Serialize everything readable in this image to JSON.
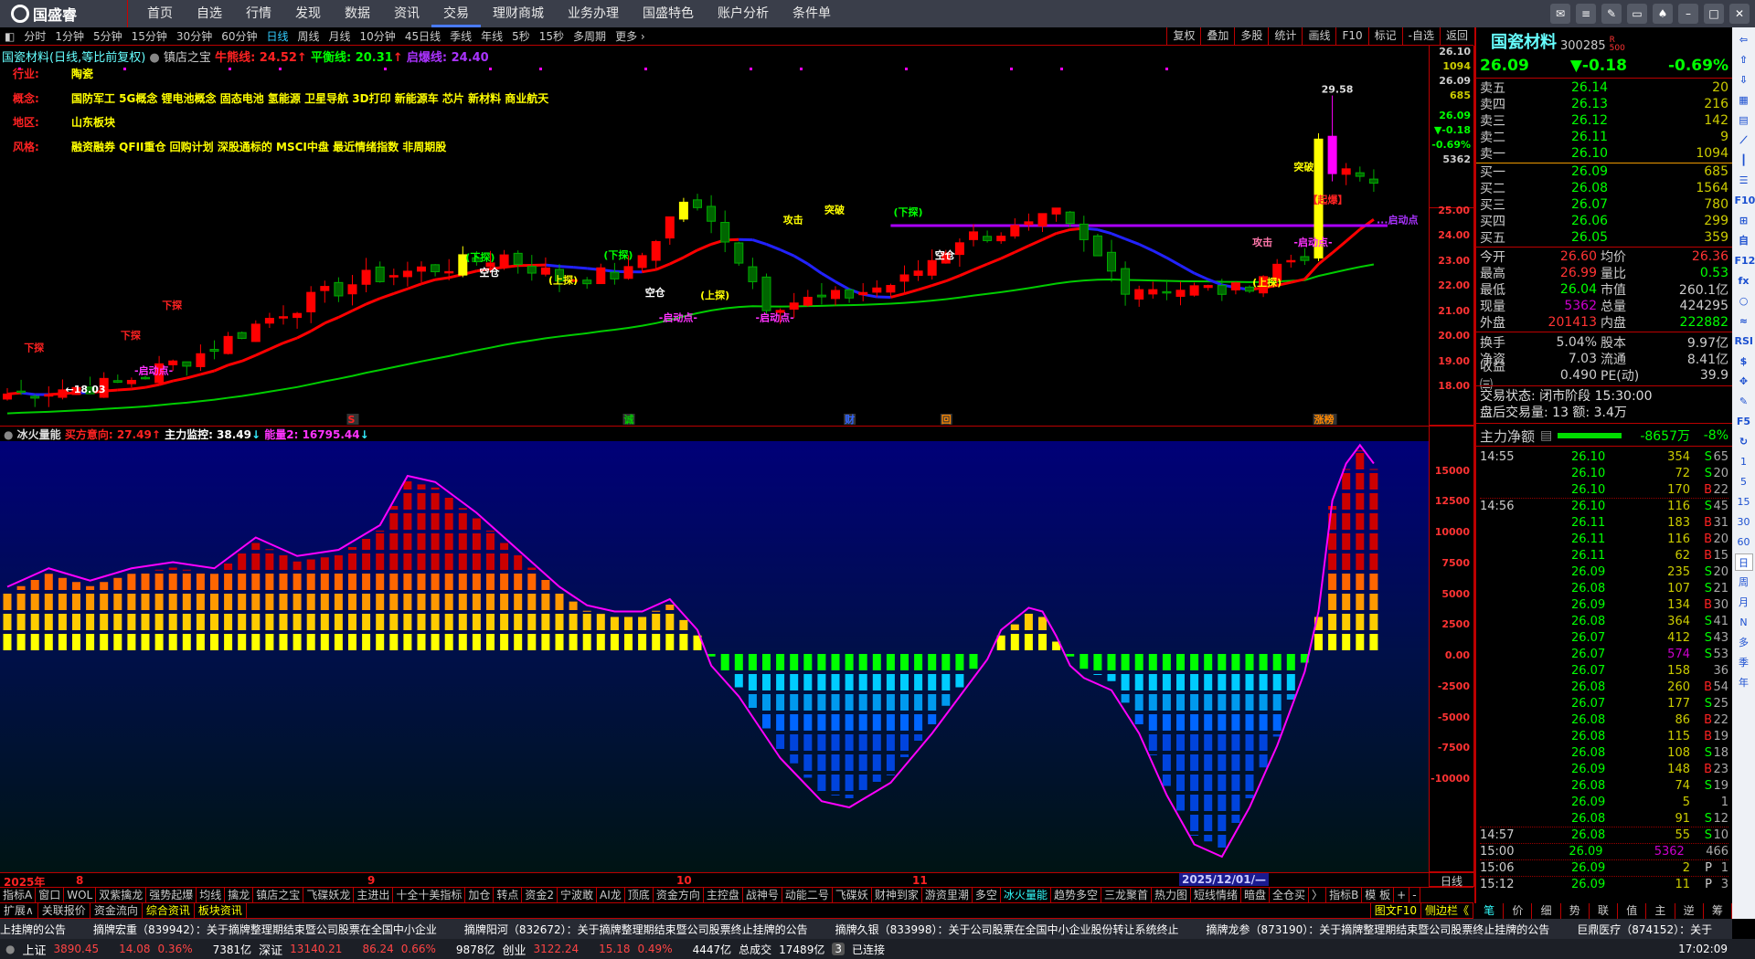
{
  "app": {
    "brand": "国盛睿"
  },
  "nav": {
    "items": [
      "首页",
      "自选",
      "行情",
      "发现",
      "数据",
      "资讯",
      "交易",
      "理财商城",
      "业务办理",
      "国盛特色",
      "账户分析",
      "条件单"
    ],
    "active": 6,
    "window_buttons": [
      "message-icon",
      "menu-icon",
      "skin-icon",
      "screen-icon",
      "shirt-icon",
      "minimize-icon",
      "maximize-icon",
      "close-icon"
    ]
  },
  "toolbar": {
    "periods": [
      "分时",
      "1分钟",
      "5分钟",
      "15分钟",
      "30分钟",
      "60分钟",
      "日线",
      "周线",
      "月线",
      "10分钟",
      "45日线",
      "季线",
      "年线",
      "5秒",
      "15秒",
      "多周期",
      "更多 ›"
    ],
    "active": 6,
    "right": [
      "复权",
      "叠加",
      "多股",
      "统计",
      "画线",
      "F10",
      "标记",
      "-自选",
      "返回"
    ]
  },
  "chart_header": {
    "title": "国瓷材料(日线,等比前复权)",
    "indicator": "镇店之宝",
    "bull_label": "牛熊线: 24.52",
    "balance_label": "平衡线: 20.31",
    "burst_label": "启爆线: 24.40"
  },
  "info": [
    {
      "k": "行业:",
      "v": "陶瓷"
    },
    {
      "k": "概念:",
      "v": "国防军工 5G概念 锂电池概念 固态电池 氢能源 卫星导航 3D打印 新能源车 芯片 新材料 商业航天"
    },
    {
      "k": "地区:",
      "v": "山东板块"
    },
    {
      "k": "风格:",
      "v": "融资融券 QFII重仓 回购计划 深股通标的 MSCI中盘 最近情绪指数 非周期股"
    }
  ],
  "price_box": [
    "26.10",
    "1094",
    "26.09",
    "685",
    "26.09",
    "▼-0.18",
    "-0.69%",
    "5362"
  ],
  "price_axis": [
    "25.00",
    "24.00",
    "23.00",
    "22.00",
    "21.00",
    "20.00",
    "19.00",
    "18.00"
  ],
  "chart_data": {
    "type": "candlestick",
    "price_range": [
      17.0,
      30.0
    ],
    "close_anchors": [
      [
        0,
        17.7
      ],
      [
        8,
        18.1
      ],
      [
        14,
        19.3
      ],
      [
        20,
        21.0
      ],
      [
        26,
        22.3
      ],
      [
        32,
        22.8
      ],
      [
        36,
        23.2
      ],
      [
        40,
        22.3
      ],
      [
        45,
        22.5
      ],
      [
        49,
        25.4
      ],
      [
        52,
        24.0
      ],
      [
        55,
        21.3
      ],
      [
        60,
        21.5
      ],
      [
        65,
        22.2
      ],
      [
        69,
        23.9
      ],
      [
        74,
        24.3
      ],
      [
        76,
        24.8
      ],
      [
        79,
        23.1
      ],
      [
        81,
        22.0
      ],
      [
        89,
        21.8
      ],
      [
        92,
        22.8
      ],
      [
        94,
        23.3
      ],
      [
        95,
        27.5
      ],
      [
        96,
        26.5
      ],
      [
        97,
        26.4
      ],
      [
        98,
        26.3
      ],
      [
        99,
        26.09
      ]
    ],
    "burst_line": 24.4,
    "high_mark": 29.58,
    "low_mark": 18.03,
    "annotations": [
      {
        "t": "←18.03",
        "i": 5,
        "p": 17.75,
        "c": "#fff"
      },
      {
        "t": "下探",
        "i": 2,
        "p": 19.4,
        "c": "#f22"
      },
      {
        "t": "下探",
        "i": 9,
        "p": 19.9,
        "c": "#f22"
      },
      {
        "t": "下探",
        "i": 12,
        "p": 21.1,
        "c": "#f22"
      },
      {
        "t": "-启动点-",
        "i": 10,
        "p": 18.5,
        "c": "#f3f"
      },
      {
        "t": "(下探)",
        "i": 34,
        "p": 23.0,
        "c": "#0f0"
      },
      {
        "t": "空仓",
        "i": 35,
        "p": 22.4,
        "c": "#fff"
      },
      {
        "t": "(上探)",
        "i": 40,
        "p": 22.1,
        "c": "#ff0"
      },
      {
        "t": "(下探)",
        "i": 44,
        "p": 23.1,
        "c": "#0f0"
      },
      {
        "t": "空仓",
        "i": 47,
        "p": 21.6,
        "c": "#fff"
      },
      {
        "t": "(上探)",
        "i": 51,
        "p": 21.5,
        "c": "#ff0"
      },
      {
        "t": "-启动点-",
        "i": 48,
        "p": 20.6,
        "c": "#f3f"
      },
      {
        "t": "-启动点-",
        "i": 55,
        "p": 20.6,
        "c": "#f3f"
      },
      {
        "t": "攻击",
        "i": 57,
        "p": 24.5,
        "c": "#ff0"
      },
      {
        "t": "突破",
        "i": 60,
        "p": 24.9,
        "c": "#ff0"
      },
      {
        "t": "(下探)",
        "i": 65,
        "p": 24.8,
        "c": "#0f0"
      },
      {
        "t": "空仓",
        "i": 68,
        "p": 23.1,
        "c": "#fff"
      },
      {
        "t": "攻击",
        "i": 91,
        "p": 23.6,
        "c": "#f7a"
      },
      {
        "t": "-启动点-",
        "i": 94,
        "p": 23.6,
        "c": "#f3f"
      },
      {
        "t": "(上探)",
        "i": 91,
        "p": 22.0,
        "c": "#ff0"
      },
      {
        "t": "突破",
        "i": 94,
        "p": 26.6,
        "c": "#ff0"
      },
      {
        "t": "【起爆】",
        "i": 95,
        "p": 25.3,
        "c": "#f22"
      },
      {
        "t": "29.58",
        "i": 96,
        "p": 29.7,
        "c": "#ddd"
      },
      {
        "t": "...启动点",
        "i": 100,
        "p": 24.5,
        "c": "#a3f"
      }
    ],
    "tags": [
      {
        "t": "S",
        "i": 25,
        "c": "#f22"
      },
      {
        "t": "诚",
        "i": 45,
        "c": "#0c0"
      },
      {
        "t": "财",
        "i": 61,
        "c": "#36f"
      },
      {
        "t": "回",
        "i": 68,
        "c": "#f80"
      },
      {
        "t": "涨榜",
        "i": 95,
        "c": "#f80"
      }
    ]
  },
  "indicator": {
    "name": "冰火量能",
    "buy_intent": "买方意向: 27.49",
    "main_monitor": "主力监控: 38.49",
    "energy": "能量2: 16795.44",
    "axis": [
      "15000",
      "12500",
      "10000",
      "7500",
      "5000",
      "2500",
      "0.00",
      "-2500",
      "-5000",
      "-7500",
      "-10000"
    ],
    "value_anchors": [
      [
        0,
        5000
      ],
      [
        3,
        6500
      ],
      [
        6,
        5500
      ],
      [
        9,
        6500
      ],
      [
        12,
        7000
      ],
      [
        15,
        6500
      ],
      [
        18,
        9000
      ],
      [
        21,
        7500
      ],
      [
        24,
        8000
      ],
      [
        27,
        10000
      ],
      [
        29,
        14000
      ],
      [
        31,
        13500
      ],
      [
        34,
        11000
      ],
      [
        37,
        8000
      ],
      [
        40,
        5000
      ],
      [
        42,
        3500
      ],
      [
        44,
        3000
      ],
      [
        46,
        3000
      ],
      [
        48,
        4000
      ],
      [
        50,
        1500
      ],
      [
        51,
        -500
      ],
      [
        53,
        -3000
      ],
      [
        56,
        -8000
      ],
      [
        59,
        -11500
      ],
      [
        61,
        -12000
      ],
      [
        64,
        -10000
      ],
      [
        67,
        -6000
      ],
      [
        70,
        -1500
      ],
      [
        72,
        1500
      ],
      [
        74,
        3300
      ],
      [
        75,
        3000
      ],
      [
        76,
        1000
      ],
      [
        77,
        -500
      ],
      [
        78,
        -1500
      ],
      [
        80,
        -2500
      ],
      [
        82,
        -6000
      ],
      [
        84,
        -11000
      ],
      [
        86,
        -15000
      ],
      [
        88,
        -16000
      ],
      [
        90,
        -12000
      ],
      [
        92,
        -7000
      ],
      [
        94,
        -1000
      ],
      [
        95,
        3000
      ],
      [
        96,
        12000
      ],
      [
        97,
        15000
      ],
      [
        98,
        16500
      ],
      [
        99,
        15000
      ]
    ]
  },
  "date_axis": {
    "year": "2025年",
    "months": [
      {
        "t": "8",
        "i": 5
      },
      {
        "t": "9",
        "i": 26
      },
      {
        "t": "10",
        "i": 49
      },
      {
        "t": "11",
        "i": 66
      }
    ],
    "cursor": "2025/12/01/—",
    "period": "日线"
  },
  "tabs": [
    "指标A",
    "窗口",
    "WOL",
    "双紫擒龙",
    "强势起爆",
    "均线",
    "擒龙",
    "镇店之宝",
    "飞碟妖龙",
    "主进出",
    "十全十美指标",
    "加仓",
    "转点",
    "资金2",
    "宁波敢",
    "AI龙",
    "顶底",
    "资金方向",
    "主控盘",
    "战神号",
    "动能二号",
    "飞碟妖",
    "财神到家",
    "游资里潮",
    "多空",
    "冰火量能",
    "趋势多空",
    "三龙聚首",
    "热力图",
    "短线情绪",
    "暗盘",
    "全仓买",
    "〉",
    "指标B",
    "模 板",
    "+",
    "-"
  ],
  "tab_active": 25,
  "row2": [
    "扩展∧",
    "关联报价",
    "资金流向",
    "综合资讯",
    "板块资讯"
  ],
  "row2_right": {
    "f10": "图文F10",
    "sidebar": "侧边栏《",
    "tabs": [
      "笔",
      "价",
      "细",
      "势",
      "联",
      "值",
      "主",
      "逆",
      "筹"
    ]
  },
  "ticker": [
    "上挂牌的公告",
    "摘牌宏重（839942）：关于摘牌整理期结束暨公司股票在全国中小企业",
    "摘牌阳河（832672）：关于摘牌整理期结束暨公司股票终止挂牌的公告",
    "摘牌久银（833998）：关于公司股票在全国中小企业股份转让系统终止",
    "摘牌龙参（873190）：关于摘牌整理期结束暨公司股票终止挂牌的公告",
    "巨鼎医疗（874152）：关于"
  ],
  "status": {
    "sh": {
      "name": "上证",
      "val": "3890.45",
      "chg": "14.08",
      "pct": "0.36%",
      "amt": "7381亿"
    },
    "sz": {
      "name": "深证",
      "val": "13140.21",
      "chg": "86.24",
      "pct": "0.66%",
      "amt": "9878亿"
    },
    "cy": {
      "name": "创业",
      "val": "3122.24",
      "chg": "15.18",
      "pct": "0.49%",
      "amt": "4447亿"
    },
    "total_label": "总成交",
    "total": "17489亿",
    "conn_count": "3",
    "conn": "已连接",
    "time": "17:02:09"
  },
  "quote": {
    "name": "国瓷材料",
    "code": "300285",
    "flag_r": "R",
    "flag_500": "500",
    "price": "26.09",
    "change": "▼-0.18",
    "pct": "-0.69%",
    "asks": [
      {
        "l": "卖五",
        "p": "26.14",
        "v": "20"
      },
      {
        "l": "卖四",
        "p": "26.13",
        "v": "216"
      },
      {
        "l": "卖三",
        "p": "26.12",
        "v": "142"
      },
      {
        "l": "卖二",
        "p": "26.11",
        "v": "9"
      },
      {
        "l": "卖一",
        "p": "26.10",
        "v": "1094"
      }
    ],
    "bids": [
      {
        "l": "买一",
        "p": "26.09",
        "v": "685"
      },
      {
        "l": "买二",
        "p": "26.08",
        "v": "1564"
      },
      {
        "l": "买三",
        "p": "26.07",
        "v": "780"
      },
      {
        "l": "买四",
        "p": "26.06",
        "v": "299"
      },
      {
        "l": "买五",
        "p": "26.05",
        "v": "359"
      }
    ],
    "stats": [
      {
        "a": "今开",
        "av": "26.60",
        "ac": "#f33",
        "b": "均价",
        "bv": "26.36",
        "bc": "#f33"
      },
      {
        "a": "最高",
        "av": "26.99",
        "ac": "#f33",
        "b": "量比",
        "bv": "0.53",
        "bc": "#0f0"
      },
      {
        "a": "最低",
        "av": "26.04",
        "ac": "#0f0",
        "b": "市值",
        "bv": "260.1亿",
        "bc": "#ccc"
      },
      {
        "a": "现量",
        "av": "5362",
        "ac": "#c0c",
        "b": "总量",
        "bv": "424295",
        "bc": "#ccc"
      },
      {
        "a": "外盘",
        "av": "201413",
        "ac": "#f33",
        "b": "内盘",
        "bv": "222882",
        "bc": "#0f0"
      }
    ],
    "stats2": [
      {
        "a": "换手",
        "av": "5.04%",
        "b": "股本",
        "bv": "9.97亿"
      },
      {
        "a": "净资",
        "av": "7.03",
        "b": "流通",
        "bv": "8.41亿"
      },
      {
        "a": "收益㈢",
        "av": "0.490",
        "b": "PE(动)",
        "bv": "39.9"
      }
    ],
    "trade_state": "交易状态: 闭市阶段 15:30:00",
    "after_hours": "盘后交易量: 13  额: 3.4万",
    "main_flow": {
      "label": "主力净额",
      "value": "-8657万",
      "pct": "-8%"
    },
    "ticks": [
      {
        "t": "14:55",
        "p": "26.10",
        "v": "354",
        "d": "S",
        "n": "65"
      },
      {
        "t": "",
        "p": "26.10",
        "v": "72",
        "d": "S",
        "n": "20"
      },
      {
        "t": "",
        "p": "26.10",
        "v": "170",
        "d": "B",
        "n": "22"
      },
      {
        "t": "14:56",
        "p": "26.10",
        "v": "116",
        "d": "S",
        "n": "45"
      },
      {
        "t": "",
        "p": "26.11",
        "v": "183",
        "d": "B",
        "n": "31"
      },
      {
        "t": "",
        "p": "26.11",
        "v": "116",
        "d": "B",
        "n": "20"
      },
      {
        "t": "",
        "p": "26.11",
        "v": "62",
        "d": "B",
        "n": "15"
      },
      {
        "t": "",
        "p": "26.09",
        "v": "235",
        "d": "S",
        "n": "20"
      },
      {
        "t": "",
        "p": "26.08",
        "v": "107",
        "d": "S",
        "n": "21"
      },
      {
        "t": "",
        "p": "26.09",
        "v": "134",
        "d": "B",
        "n": "30"
      },
      {
        "t": "",
        "p": "26.08",
        "v": "364",
        "d": "S",
        "n": "41"
      },
      {
        "t": "",
        "p": "26.07",
        "v": "412",
        "d": "S",
        "n": "43"
      },
      {
        "t": "",
        "p": "26.07",
        "v": "574",
        "d": "S",
        "n": "53"
      },
      {
        "t": "",
        "p": "26.07",
        "v": "158",
        "d": "",
        "n": "36"
      },
      {
        "t": "",
        "p": "26.08",
        "v": "260",
        "d": "B",
        "n": "54"
      },
      {
        "t": "",
        "p": "26.07",
        "v": "177",
        "d": "S",
        "n": "25"
      },
      {
        "t": "",
        "p": "26.08",
        "v": "86",
        "d": "B",
        "n": "22"
      },
      {
        "t": "",
        "p": "26.08",
        "v": "115",
        "d": "B",
        "n": "19"
      },
      {
        "t": "",
        "p": "26.08",
        "v": "108",
        "d": "S",
        "n": "18"
      },
      {
        "t": "",
        "p": "26.09",
        "v": "148",
        "d": "B",
        "n": "23"
      },
      {
        "t": "",
        "p": "26.08",
        "v": "74",
        "d": "S",
        "n": "19"
      },
      {
        "t": "",
        "p": "26.09",
        "v": "5",
        "d": "",
        "n": "1"
      },
      {
        "t": "",
        "p": "26.08",
        "v": "91",
        "d": "S",
        "n": "12"
      },
      {
        "t": "14:57",
        "p": "26.08",
        "v": "55",
        "d": "S",
        "n": "10"
      },
      {
        "t": "15:00",
        "p": "26.09",
        "v": "5362",
        "d": "",
        "n": "466"
      },
      {
        "t": "15:06",
        "p": "26.09",
        "v": "2",
        "d": "P",
        "n": "1"
      },
      {
        "t": "15:12",
        "p": "26.09",
        "v": "11",
        "d": "P",
        "n": "3"
      }
    ]
  },
  "side": {
    "icons": [
      "arrow-left-icon",
      "arrow-up-icon",
      "arrow-down-icon",
      "report-icon",
      "table-icon",
      "line-chart-icon",
      "kline-icon",
      "news-icon",
      "f10-icon",
      "tree-icon",
      "self-icon",
      "f12-icon",
      "formula-icon",
      "circle-icon",
      "wave-icon",
      "rsi-icon",
      "money-icon",
      "move-icon",
      "pencil-icon",
      "f5-icon",
      "refresh-icon"
    ],
    "periods": [
      "1",
      "5",
      "15",
      "30",
      "60",
      "日",
      "周",
      "月",
      "N",
      "多",
      "季",
      "年"
    ]
  }
}
